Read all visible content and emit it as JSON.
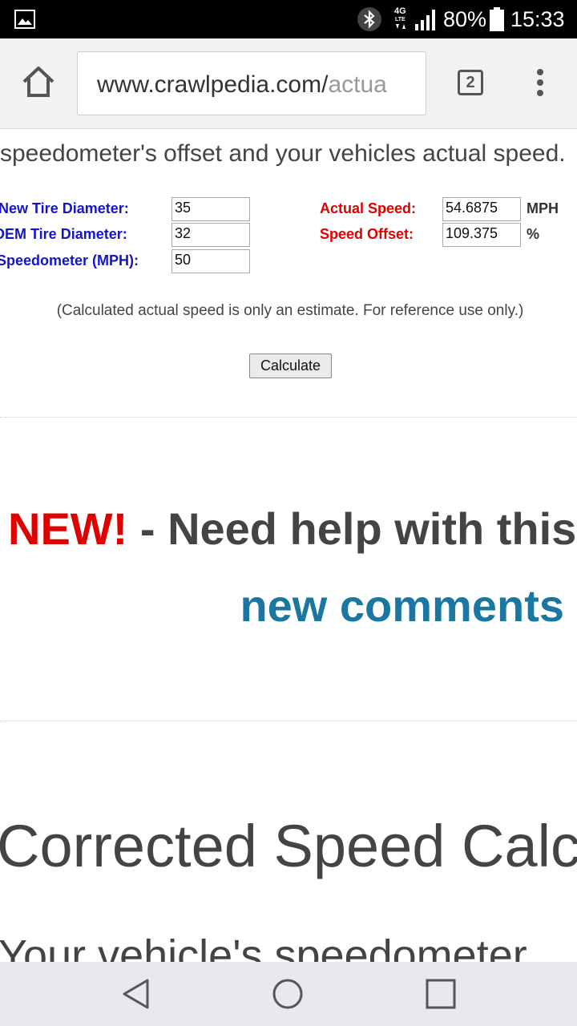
{
  "status_bar": {
    "battery_percent": "80%",
    "time": "15:33",
    "network": "4G LTE"
  },
  "browser": {
    "url_domain": "www.crawlpedia.com/",
    "url_path": "actua",
    "tab_count": "2"
  },
  "page": {
    "intro_text": "speedometer's offset and your vehicles actual speed.",
    "inputs": {
      "new_tire_label": "New Tire Diameter:",
      "new_tire_value": "35",
      "oem_tire_label": "OEM Tire Diameter:",
      "oem_tire_value": "32",
      "speedometer_label": "Speedometer (MPH):",
      "speedometer_value": "50"
    },
    "outputs": {
      "actual_speed_label": "Actual Speed:",
      "actual_speed_value": "54.6875",
      "actual_speed_unit": "MPH",
      "speed_offset_label": "Speed Offset:",
      "speed_offset_value": "109.375",
      "speed_offset_unit": "%"
    },
    "note": "(Calculated actual speed is only an estimate. For reference use only.)",
    "calculate_button": "Calculate",
    "promo_new": "NEW!",
    "promo_text": " - Need help with this",
    "promo_link": "new comments",
    "heading": "Corrected Speed Calc",
    "cut_text": "Your vehicle's speedometer"
  }
}
